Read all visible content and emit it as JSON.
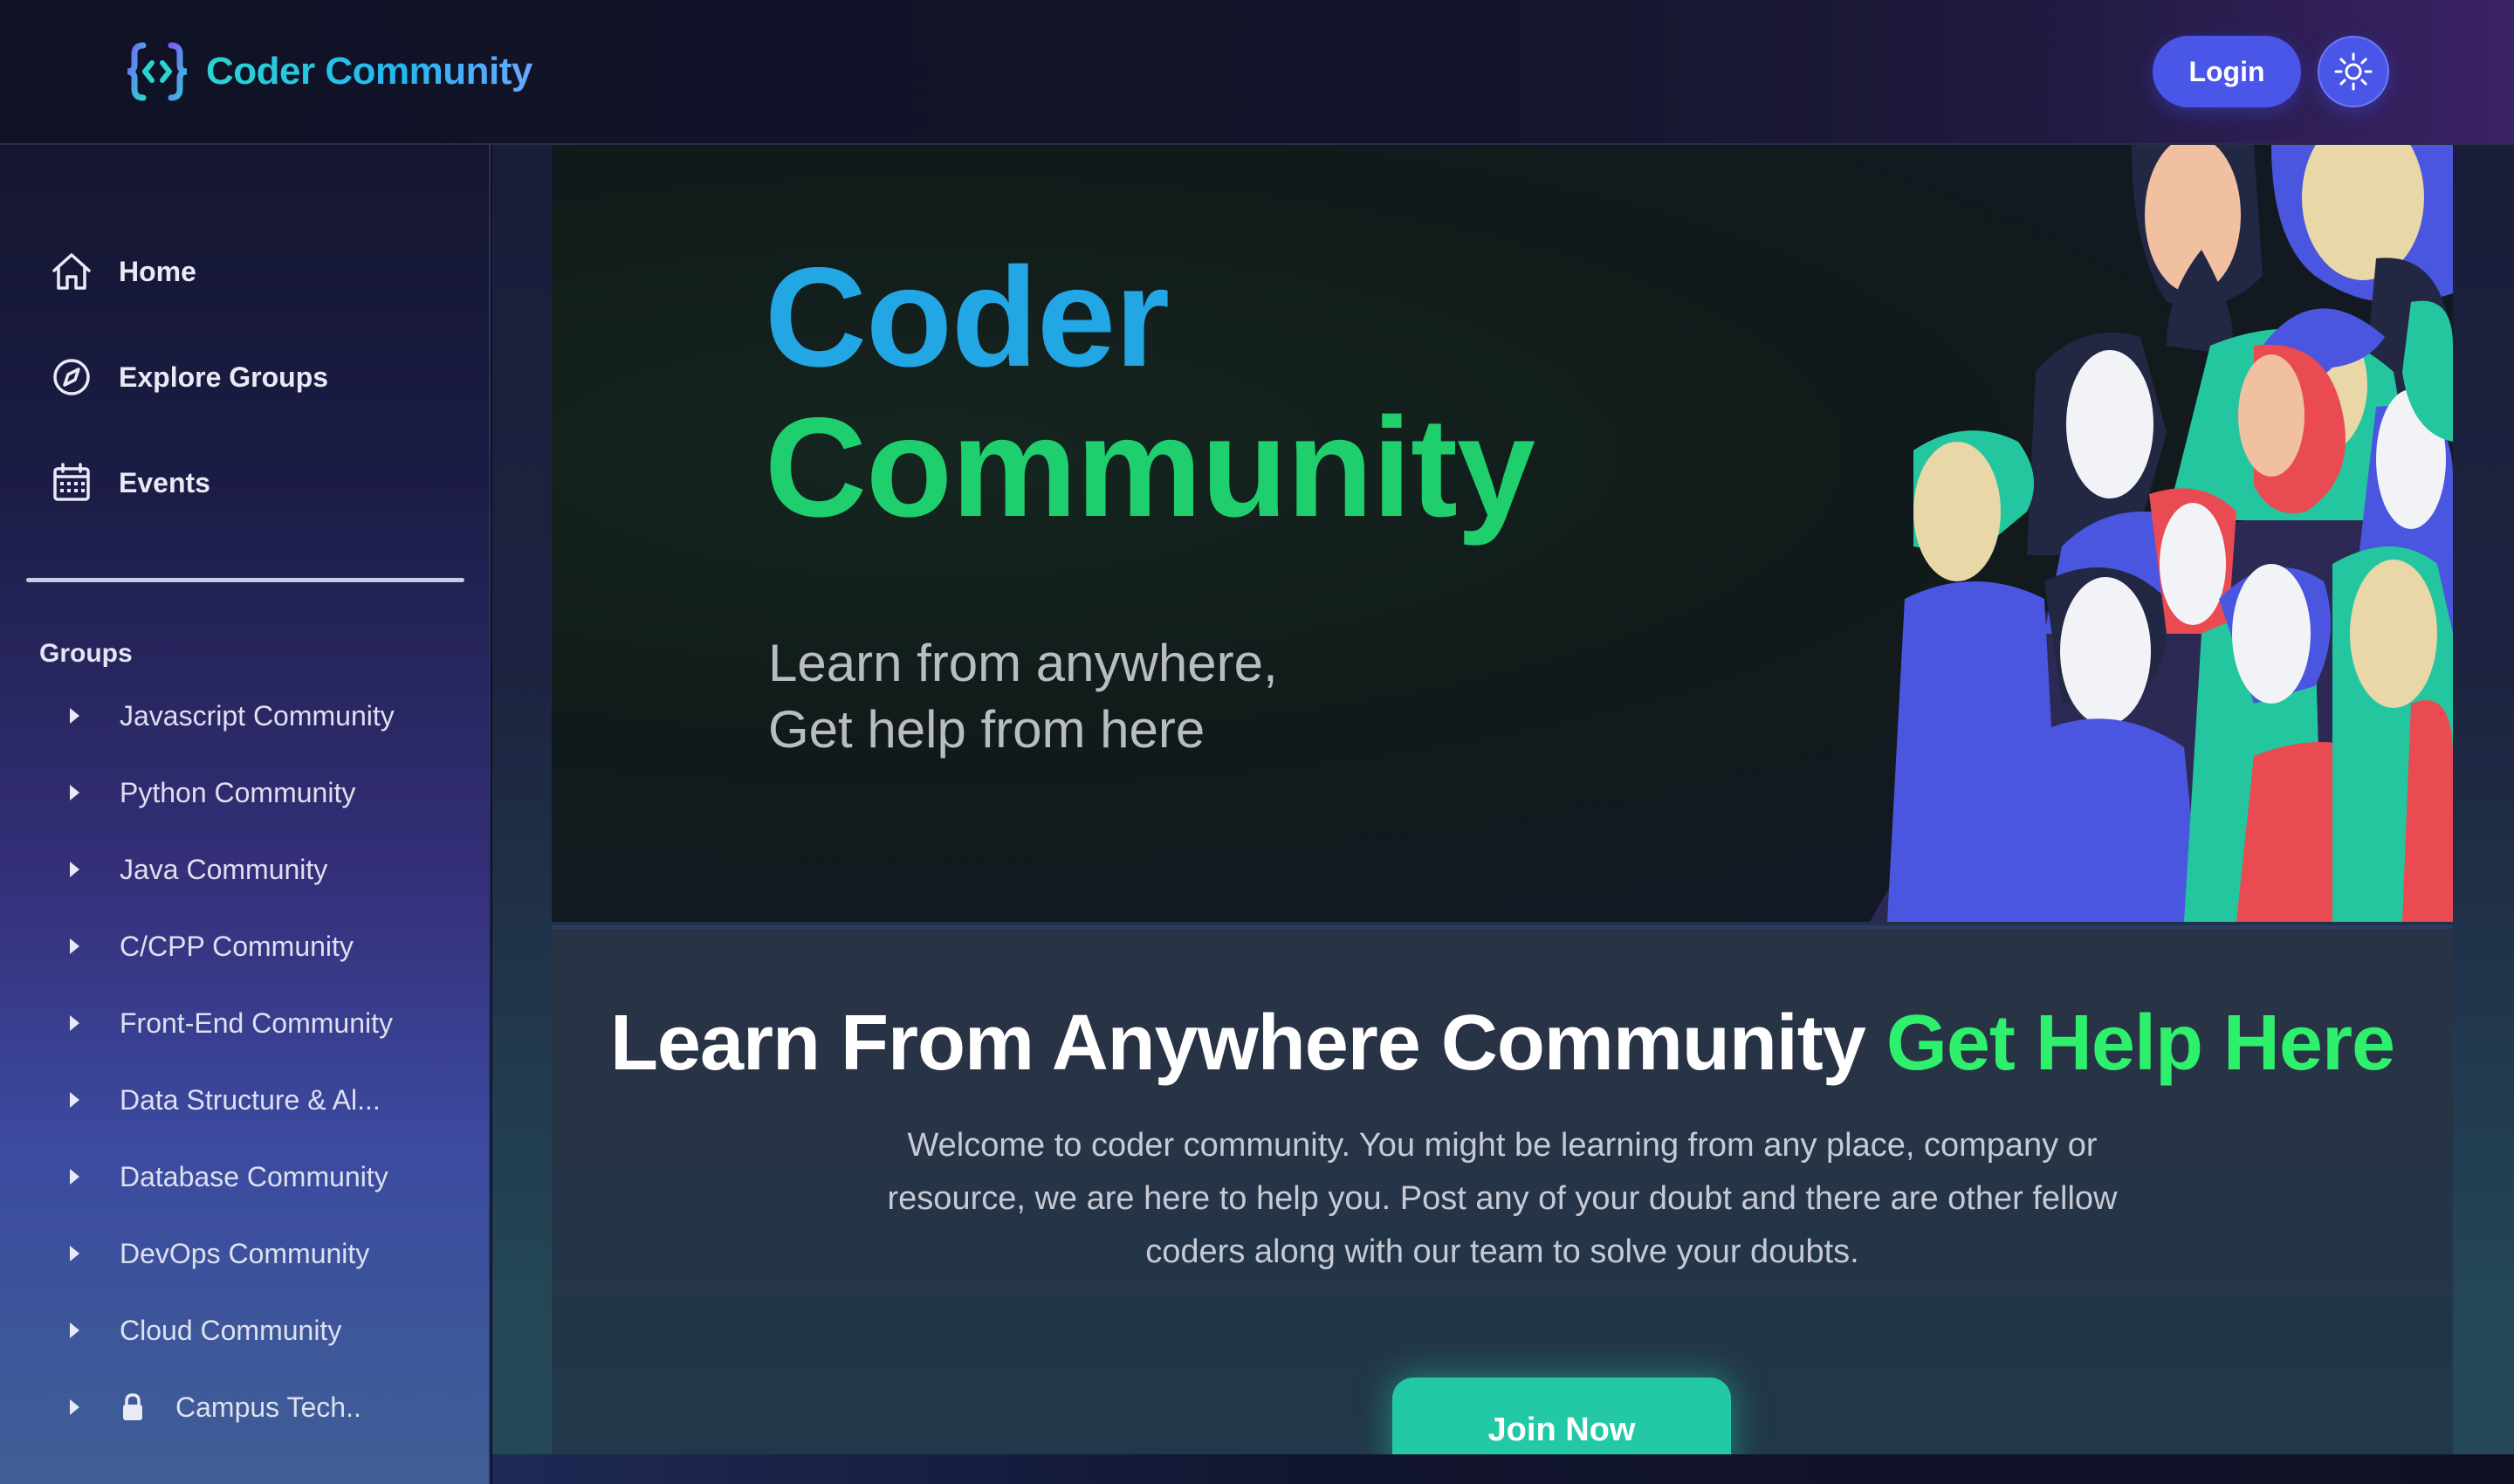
{
  "header": {
    "brand_name": "Coder Community",
    "login_label": "Login",
    "accent_color": "#4956e8"
  },
  "sidebar": {
    "nav": [
      {
        "label": "Home",
        "icon": "home-icon"
      },
      {
        "label": "Explore Groups",
        "icon": "compass-icon"
      },
      {
        "label": "Events",
        "icon": "calendar-icon"
      }
    ],
    "groups_title": "Groups",
    "groups": [
      {
        "label": "Javascript Community"
      },
      {
        "label": "Python Community"
      },
      {
        "label": "Java Community"
      },
      {
        "label": "C/CPP Community"
      },
      {
        "label": "Front-End Community"
      },
      {
        "label": "Data Structure & Al..."
      },
      {
        "label": "Database Community"
      },
      {
        "label": "DevOps Community"
      },
      {
        "label": "Cloud Community"
      },
      {
        "label": "Campus Tech..",
        "locked": true
      }
    ]
  },
  "hero": {
    "title_line1": "Coder",
    "title_line2": "Community",
    "subtitle_line1": "Learn from anywhere,",
    "subtitle_line2": "Get help from here",
    "title_color1": "#22a6e4",
    "title_color2": "#1fcf6e"
  },
  "info": {
    "heading_main": "Learn From Anywhere Community",
    "heading_accent": "Get Help Here",
    "description": "Welcome to coder community. You might be learning from any place, company or resource, we are here to help you. Post any of your doubt and there are other fellow coders along with our team to solve your doubts.",
    "join_label": "Join Now",
    "accent_color": "#2ff06d",
    "button_color": "#22c9a4"
  }
}
